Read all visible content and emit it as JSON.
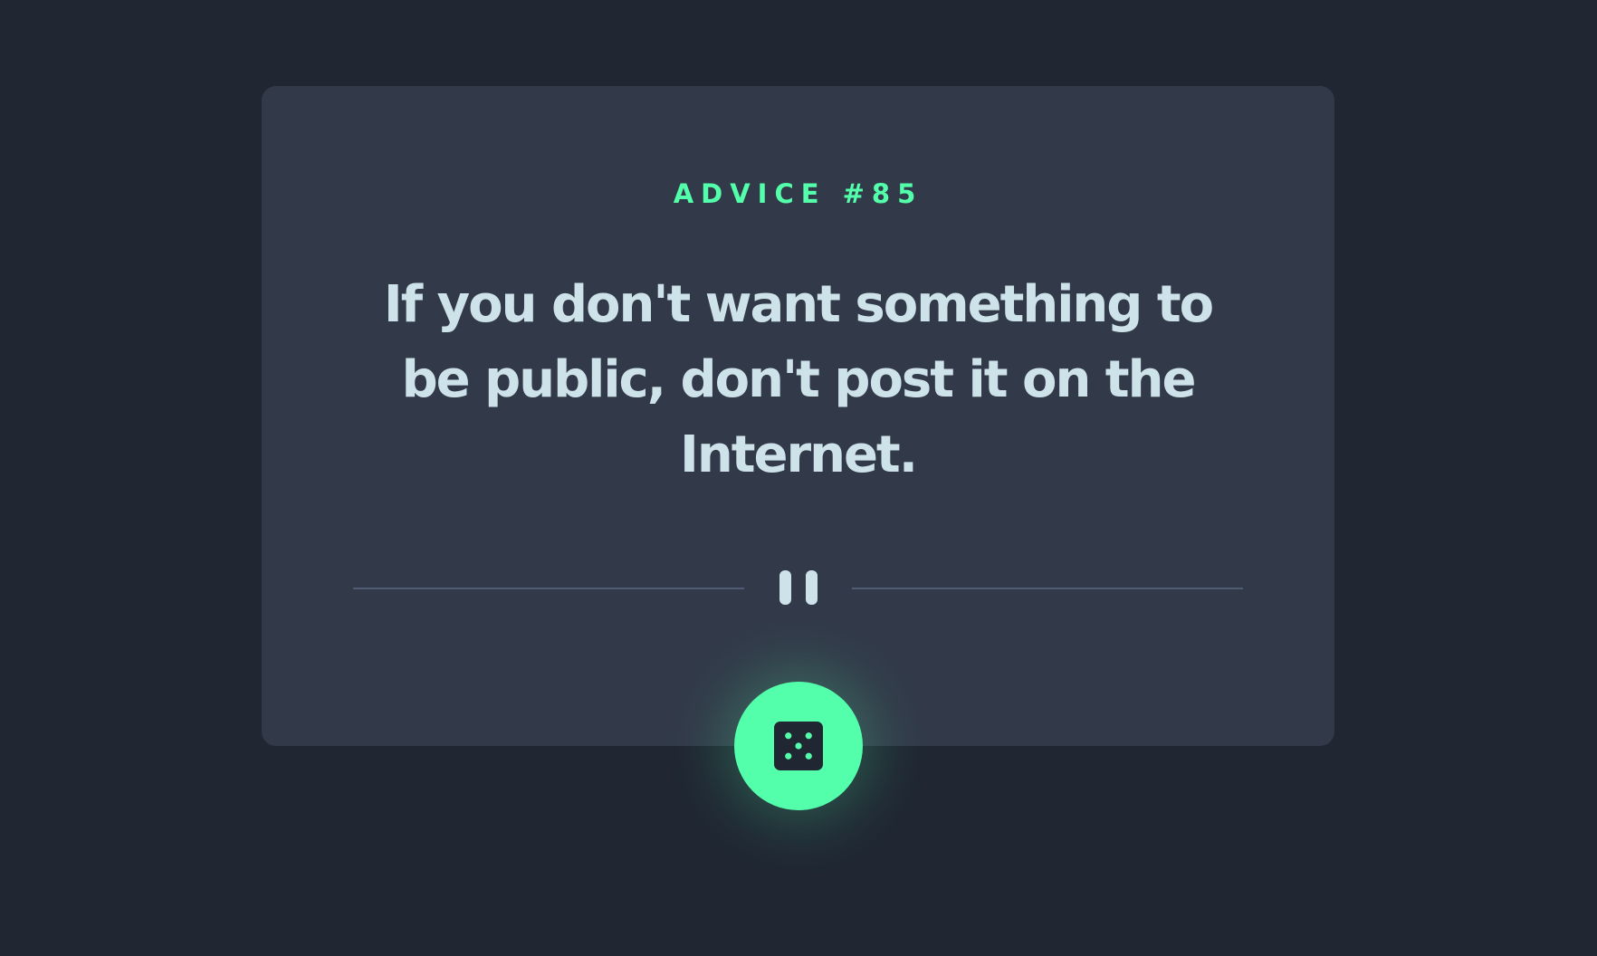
{
  "advice": {
    "label": "ADVICE #85",
    "text": "If you don't want something to be public, don't post it on the Internet."
  },
  "icons": {
    "divider": "pause-icon",
    "button": "dice-icon"
  },
  "colors": {
    "background": "#202733",
    "card": "#323a49",
    "accent": "#53ffaa",
    "text": "#cee3e9",
    "divider": "#4f5d74"
  }
}
